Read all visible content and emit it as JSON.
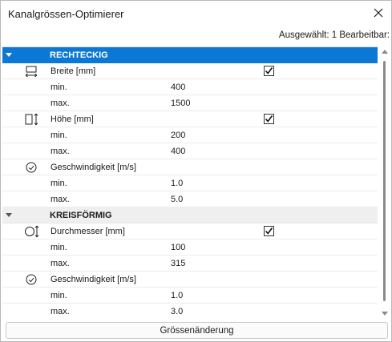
{
  "window": {
    "title": "Kanalgrössen-Optimierer",
    "selected_info": "Ausgewählt: 1 Bearbeitbar:"
  },
  "categories": [
    {
      "label": "RECHTECKIG",
      "selected": true,
      "properties": [
        {
          "icon": "width-arrows-icon",
          "label": "Breite [mm]",
          "checked": true,
          "rows": [
            {
              "label": "min.",
              "value": "400"
            },
            {
              "label": "max.",
              "value": "1500"
            }
          ]
        },
        {
          "icon": "height-arrows-icon",
          "label": "Höhe [mm]",
          "checked": true,
          "rows": [
            {
              "label": "min.",
              "value": "200"
            },
            {
              "label": "max.",
              "value": "400"
            }
          ]
        },
        {
          "icon": "speed-gauge-icon",
          "label": "Geschwindigkeit [m/s]",
          "checked": null,
          "rows": [
            {
              "label": "min.",
              "value": "1.0"
            },
            {
              "label": "max.",
              "value": "5.0"
            }
          ]
        }
      ]
    },
    {
      "label": "KREISFÖRMIG",
      "selected": false,
      "properties": [
        {
          "icon": "diameter-icon",
          "label": "Durchmesser [mm]",
          "checked": true,
          "rows": [
            {
              "label": "min.",
              "value": "100"
            },
            {
              "label": "max.",
              "value": "315"
            }
          ]
        },
        {
          "icon": "speed-gauge-icon",
          "label": "Geschwindigkeit [m/s]",
          "checked": null,
          "rows": [
            {
              "label": "min.",
              "value": "1.0"
            },
            {
              "label": "max.",
              "value": "3.0"
            }
          ]
        }
      ]
    }
  ],
  "footer": {
    "button_label": "Grössenänderung"
  },
  "colors": {
    "selection": "#0b78d6",
    "category_bg": "#efefef"
  }
}
